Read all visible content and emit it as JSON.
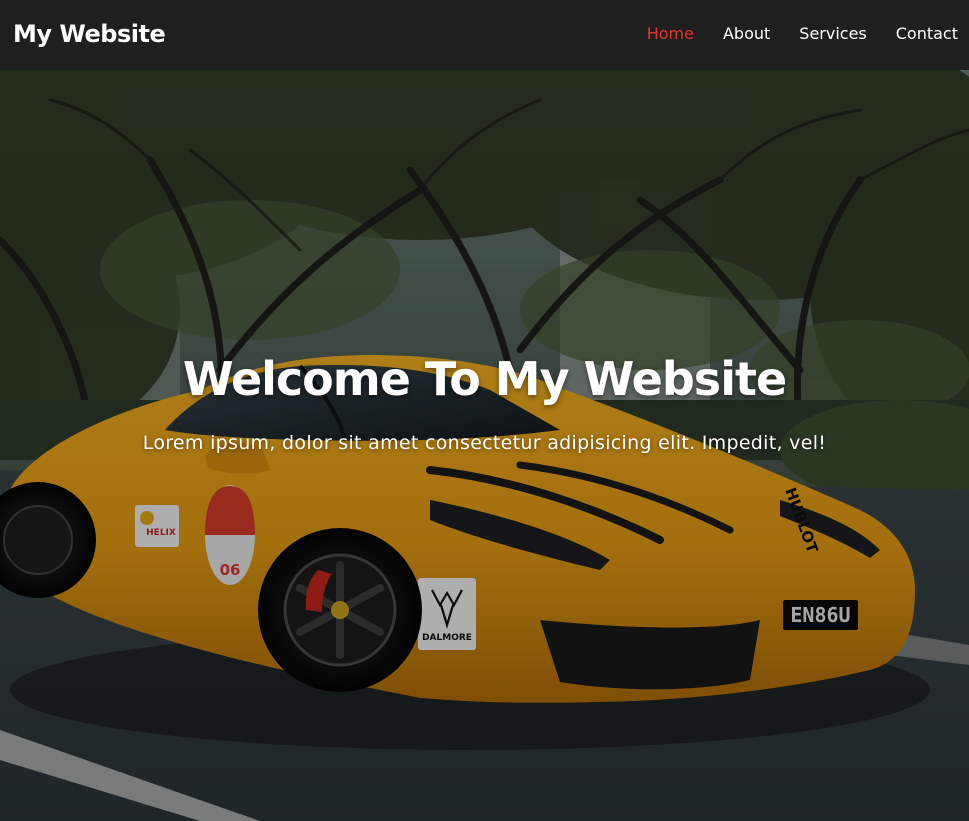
{
  "navbar": {
    "brand": "My Website",
    "links": [
      {
        "label": "Home",
        "active": true
      },
      {
        "label": "About",
        "active": false
      },
      {
        "label": "Services",
        "active": false
      },
      {
        "label": "Contact",
        "active": false
      }
    ],
    "accent_color": "#e0392b",
    "background_color": "#1f1f1f"
  },
  "hero": {
    "title": "Welcome To My Website",
    "subtitle": "Lorem ipsum, dolor sit amet consectetur adipisicing elit. Impedit, vel!",
    "car": {
      "number": "06",
      "plate": "EN86U",
      "sticker_brand": "DALMORE",
      "sticker_helix": "HELIX",
      "sponsor": "HUBLOT",
      "body_color": "#e39a14"
    }
  }
}
